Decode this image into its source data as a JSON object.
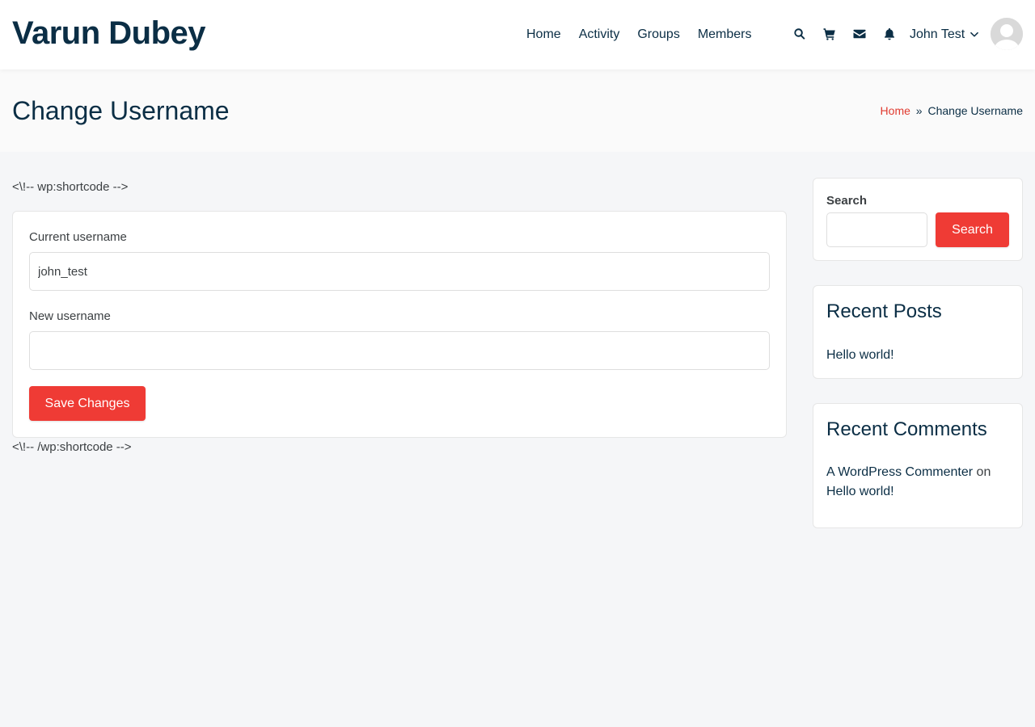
{
  "site": {
    "title": "Varun Dubey"
  },
  "nav": {
    "items": [
      {
        "label": "Home"
      },
      {
        "label": "Activity"
      },
      {
        "label": "Groups"
      },
      {
        "label": "Members"
      }
    ],
    "icons": [
      "search-icon",
      "cart-icon",
      "envelope-icon",
      "bell-icon"
    ],
    "user": {
      "name": "John Test"
    }
  },
  "page": {
    "title": "Change Username",
    "breadcrumb": {
      "home": "Home",
      "separator": "»",
      "current": "Change Username"
    }
  },
  "content": {
    "shortcode_open": "<\\!-- wp:shortcode -->",
    "shortcode_close": "<\\!-- /wp:shortcode -->",
    "form": {
      "current_label": "Current username",
      "current_value": "john_test",
      "new_label": "New username",
      "new_value": "",
      "save_label": "Save Changes"
    }
  },
  "sidebar": {
    "search": {
      "label": "Search",
      "placeholder": "",
      "button_label": "Search"
    },
    "recent_posts": {
      "title": "Recent Posts",
      "items": [
        {
          "label": "Hello world!"
        }
      ]
    },
    "recent_comments": {
      "title": "Recent Comments",
      "items": [
        {
          "author": "A WordPress Commenter",
          "connector": "on",
          "post": "Hello world!"
        }
      ]
    }
  },
  "colors": {
    "accent": "#ef3b35",
    "heading": "#0b2e45",
    "page_background": "#f5f6f8"
  }
}
